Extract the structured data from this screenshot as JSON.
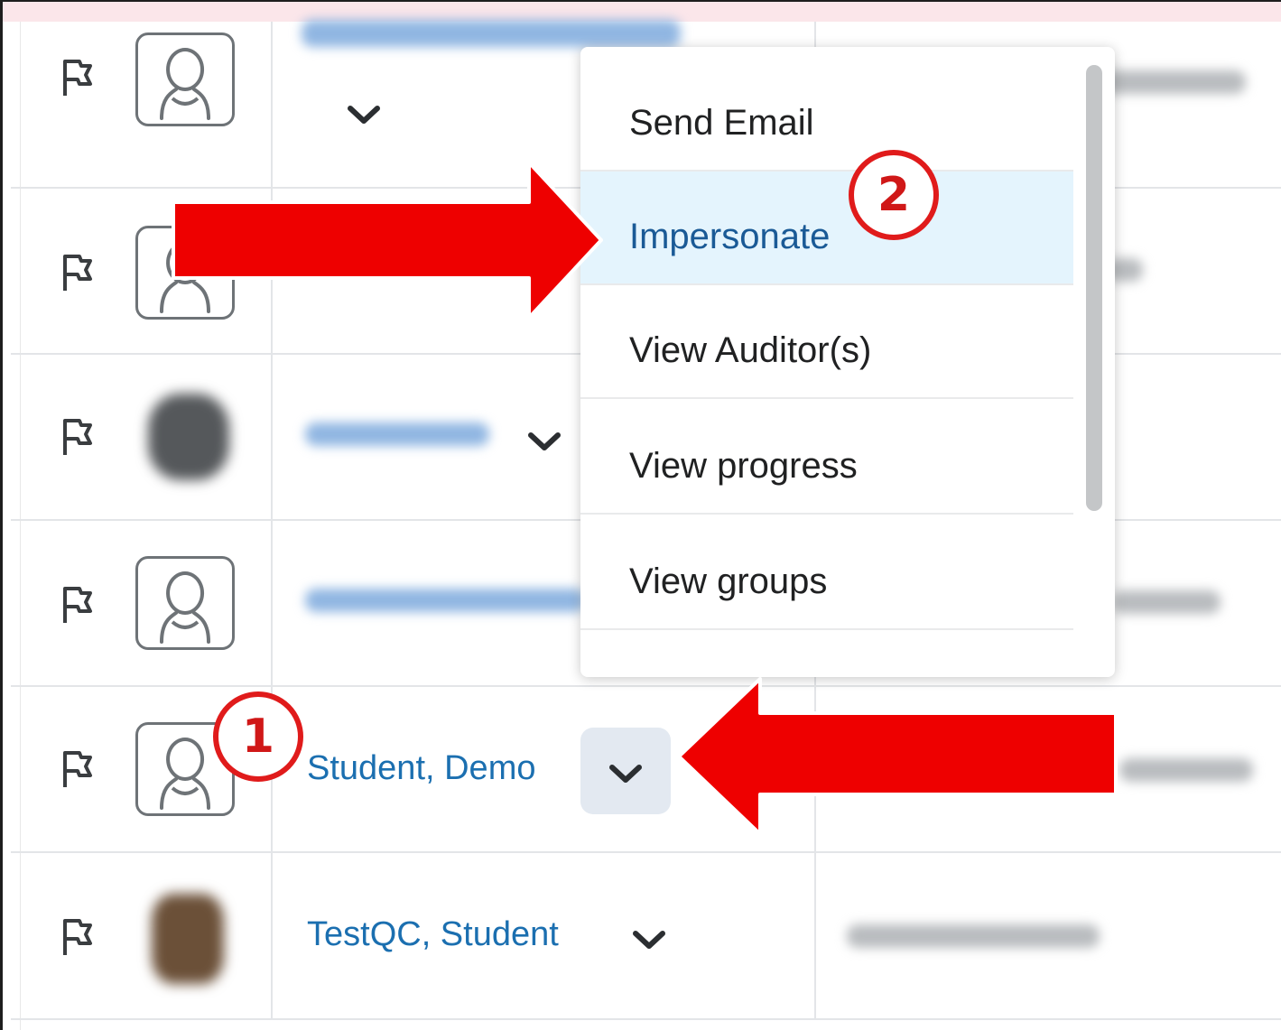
{
  "dropdown": {
    "items": [
      {
        "label": "Send Email"
      },
      {
        "label": "Impersonate"
      },
      {
        "label": "View Auditor(s)"
      },
      {
        "label": "View progress"
      },
      {
        "label": "View groups"
      }
    ],
    "highlighted_item": "Impersonate"
  },
  "rows": [
    {
      "name": "Student, Demo"
    },
    {
      "name": "TestQC, Student"
    }
  ],
  "callouts": {
    "step1": "1",
    "step2": "2"
  },
  "colors": {
    "link": "#1b6fb0",
    "highlight": "#e4f4fd",
    "callout_red": "#e01b1b",
    "arrow_red": "#ee0000"
  },
  "icons": [
    "flag-icon",
    "user-avatar-icon",
    "chevron-down-icon"
  ]
}
